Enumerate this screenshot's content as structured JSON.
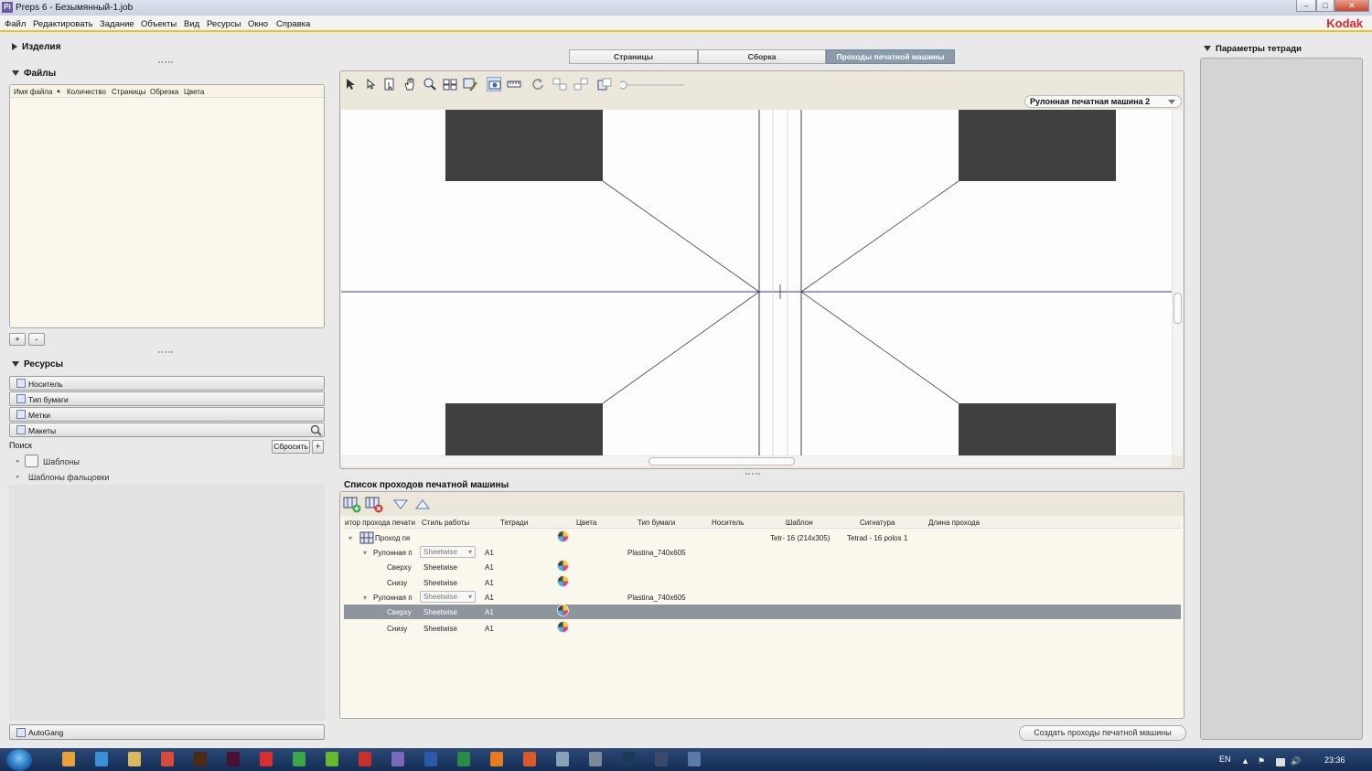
{
  "window": {
    "title": "Preps 6 - Безымянный-1.job",
    "app_icon": "Pi",
    "brand": "Kodak",
    "controls": [
      "–",
      "□",
      "✕"
    ]
  },
  "menu": [
    "Файл",
    "Редактировать",
    "Задание",
    "Объекты",
    "Вид",
    "Ресурсы",
    "Окно",
    "Справка"
  ],
  "left": {
    "products_title": "Изделия",
    "files_title": "Файлы",
    "files_columns": [
      "Имя файла",
      "Количество",
      "Страницы",
      "Обрезка",
      "Цвета"
    ],
    "add_label": "+",
    "remove_label": "-",
    "resources_title": "Ресурсы",
    "resources": [
      "Носитель",
      "Тип бумаги",
      "Метки",
      "Макеты"
    ],
    "search_label": "Поиск",
    "reset_label": "Сбросить",
    "search_add": "+",
    "tree": [
      "Шаблоны",
      "Шаблоны фальцовки"
    ],
    "autogang": "AutoGang"
  },
  "tabs": [
    "Страницы",
    "Сборка",
    "Проходы печатной машины"
  ],
  "canvas": {
    "press_select": "Рулонная печатная машина 2"
  },
  "list": {
    "title": "Список проходов печатной машины",
    "columns": [
      "итор прохода печати",
      "Стиль работы",
      "Тетради",
      "Цвета",
      "Тип бумаги",
      "Носитель",
      "Шаблон",
      "Сигнатура",
      "Длина прохода"
    ],
    "root": {
      "name": "Проход пе",
      "template": "Tetr- 16 (214x305)",
      "signature": "Tetrad - 16 polos 1"
    },
    "press_row_label": "Рулонная п",
    "press_style": "Sheetwise",
    "press_sig": "A1",
    "paper": "Plastina_740x605",
    "top_label": "Сверху",
    "bottom_label": "Снизу",
    "style": "Sheetwise",
    "sig": "A1"
  },
  "right": {
    "title": "Параметры тетради"
  },
  "create_button": "Создать проходы печатной машины",
  "taskbar": {
    "lang": "EN",
    "time": "23:36",
    "tray_up": "▲",
    "tray_flag": "⚑",
    "tray_speaker": "🔊",
    "apps": [
      {
        "name": "media-player-icon",
        "color": "#e8a23a"
      },
      {
        "name": "ie-icon",
        "color": "#3d8fd8"
      },
      {
        "name": "explorer-icon",
        "color": "#d9b860"
      },
      {
        "name": "chrome-icon",
        "color": "#d84a3a"
      },
      {
        "name": "illustrator-icon",
        "color": "#4a2a10"
      },
      {
        "name": "indesign-icon",
        "color": "#4a1030"
      },
      {
        "name": "app-red-icon",
        "color": "#d83030"
      },
      {
        "name": "app-green-icon",
        "color": "#3aa84a"
      },
      {
        "name": "app-green2-icon",
        "color": "#68b82e"
      },
      {
        "name": "acrobat-icon",
        "color": "#c8302a"
      },
      {
        "name": "preps-icon",
        "color": "#7a68b8"
      },
      {
        "name": "word-icon",
        "color": "#2a5aa8"
      },
      {
        "name": "excel-icon",
        "color": "#2a8a4a"
      },
      {
        "name": "firefox-icon",
        "color": "#e87a20"
      },
      {
        "name": "powerpoint-icon",
        "color": "#d85a28"
      },
      {
        "name": "network-icon",
        "color": "#88a0b8"
      },
      {
        "name": "archive-icon",
        "color": "#7a8a98"
      },
      {
        "name": "photoshop-icon",
        "color": "#1a3a5a"
      },
      {
        "name": "settings-icon",
        "color": "#3a4a6a"
      },
      {
        "name": "camera-icon",
        "color": "#5a7aa8"
      }
    ]
  }
}
